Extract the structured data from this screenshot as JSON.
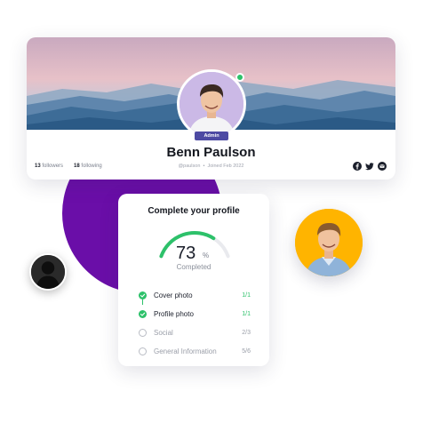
{
  "profile": {
    "name": "Benn Paulson",
    "role_badge": "Admin",
    "followers_count": "13",
    "followers_label": "followers",
    "following_count": "18",
    "following_label": "following",
    "handle": "@paulson",
    "separator": "•",
    "joined": "Joined Feb 2022",
    "online": true,
    "social_icons": [
      "facebook-icon",
      "twitter-icon",
      "email-icon"
    ]
  },
  "completion": {
    "title": "Complete your profile",
    "percent": "73",
    "percent_unit": "%",
    "percent_fraction": 0.73,
    "status_label": "Completed",
    "steps": [
      {
        "label": "Cover photo",
        "count": "1/1",
        "done": true
      },
      {
        "label": "Profile photo",
        "count": "1/1",
        "done": true
      },
      {
        "label": "Social",
        "count": "2/3",
        "done": false
      },
      {
        "label": "General Information",
        "count": "5/6",
        "done": false
      }
    ]
  },
  "colors": {
    "accent_green": "#2dc16a",
    "badge_purple": "#4d4aa3",
    "blob_purple": "#6a0ea8",
    "avatar_yellow": "#ffb400",
    "gauge_track": "#e9eaee"
  }
}
